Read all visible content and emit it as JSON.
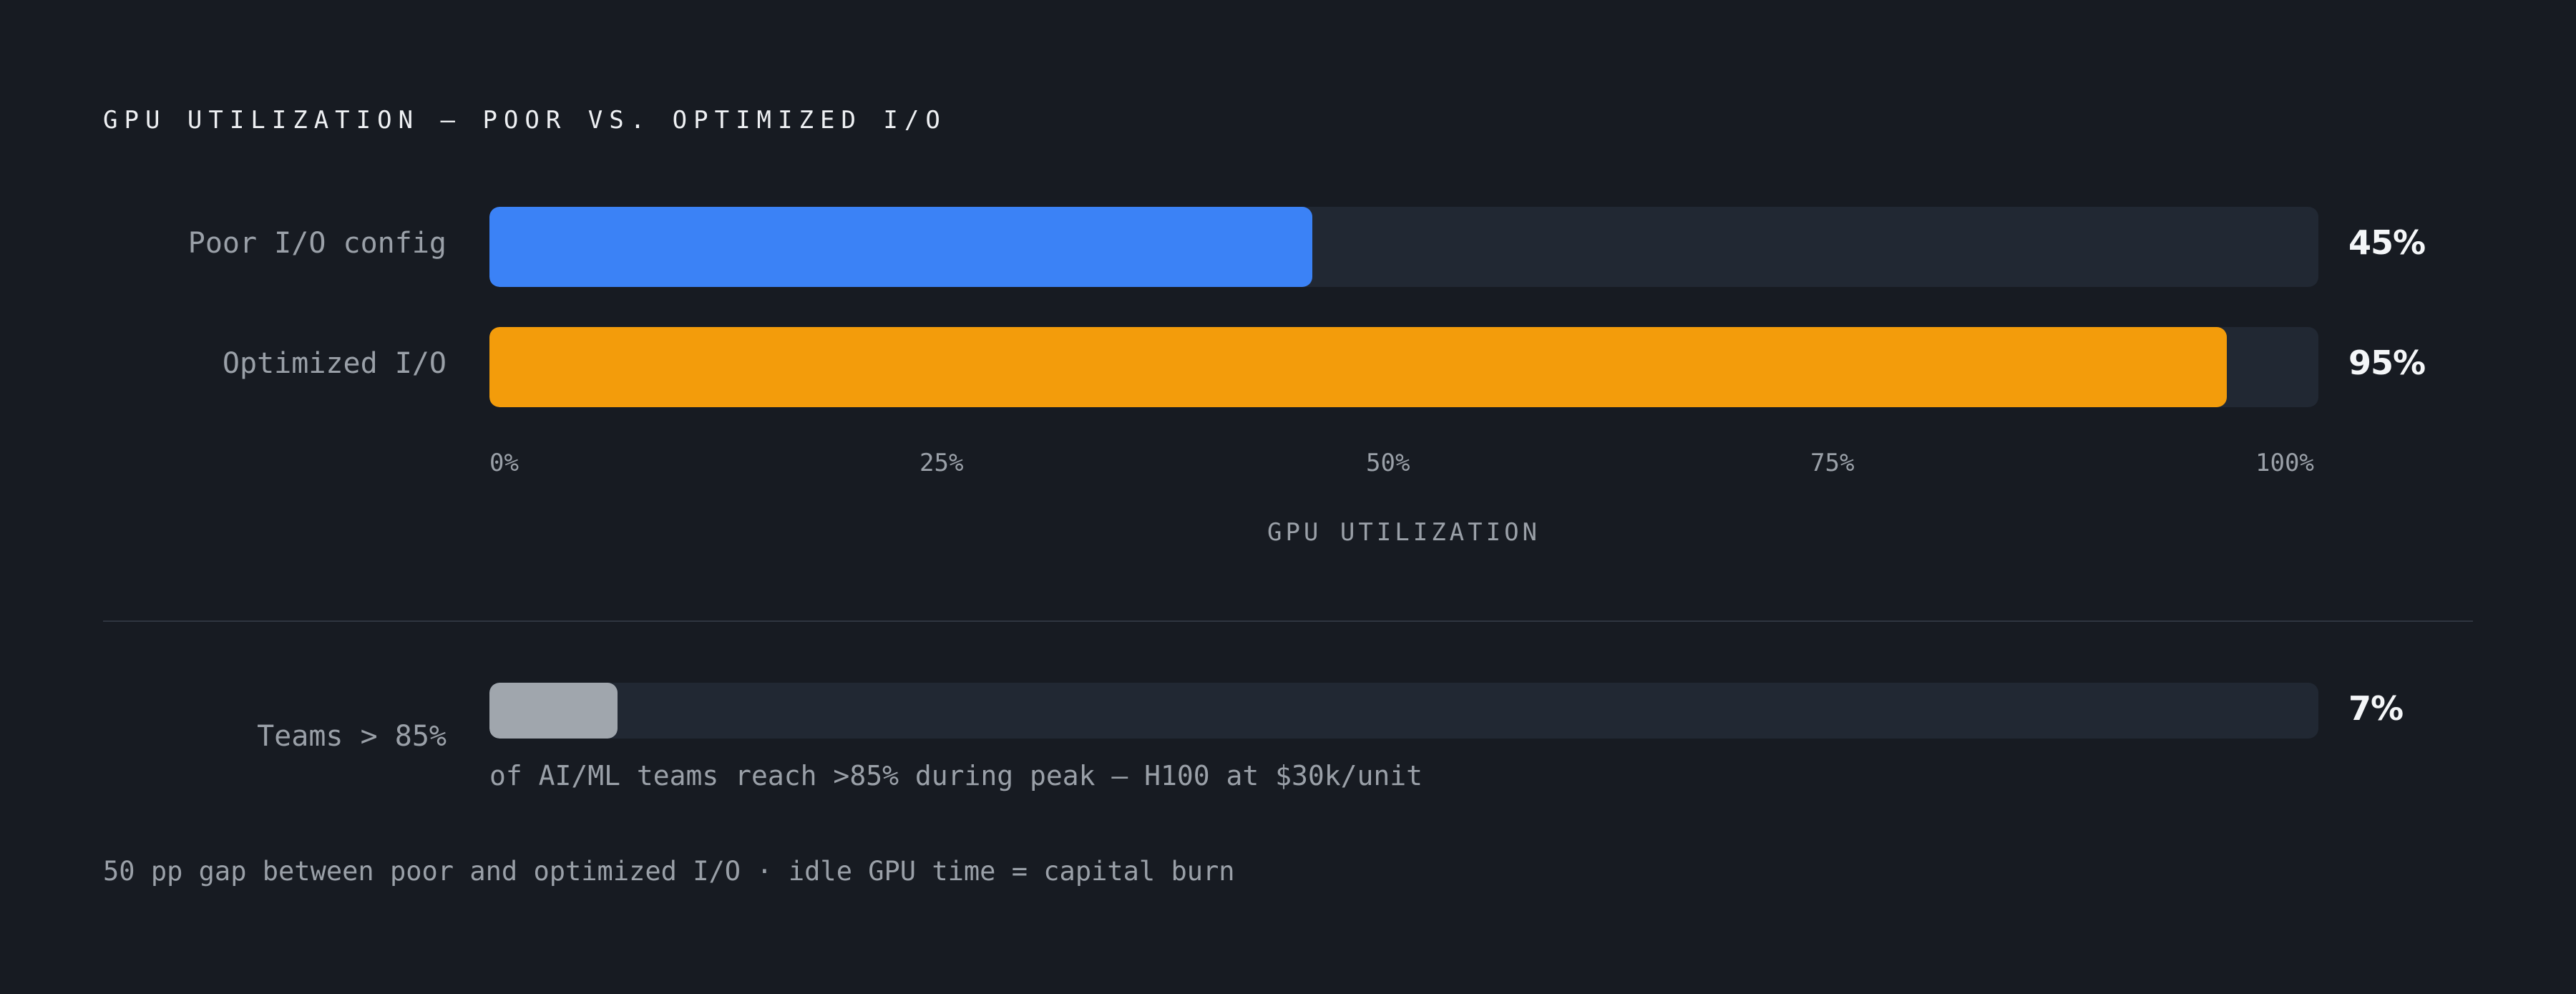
{
  "chart_data": [
    {
      "type": "bar",
      "orientation": "horizontal",
      "title": "GPU UTILIZATION — POOR VS. OPTIMIZED I/O",
      "categories": [
        "Poor I/O config",
        "Optimized I/O"
      ],
      "values": [
        45,
        95
      ],
      "value_labels": [
        "45%",
        "95%"
      ],
      "colors": [
        "#3b82f6",
        "#f39c0b"
      ],
      "track_color": "#212833",
      "xlim": [
        0,
        100
      ],
      "xticks": [
        "0%",
        "25%",
        "50%",
        "75%",
        "100%"
      ],
      "xlabel": "GPU UTILIZATION",
      "grid": false
    },
    {
      "type": "bar",
      "orientation": "horizontal",
      "categories": [
        "Teams > 85%"
      ],
      "values": [
        7
      ],
      "value_labels": [
        "7%"
      ],
      "colors": [
        "#a0a6ad"
      ],
      "track_color": "#212833",
      "xlim": [
        0,
        100
      ],
      "caption": "of AI/ML teams reach >85% during peak — H100 at $30k/unit"
    }
  ],
  "footnote": "50 pp gap between poor and optimized I/O · idle GPU time = capital burn"
}
